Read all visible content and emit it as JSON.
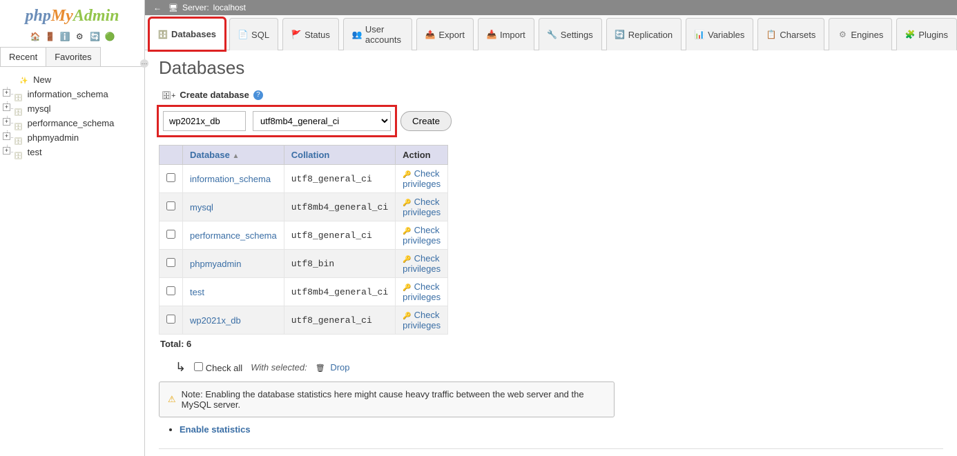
{
  "logo": {
    "php": "php",
    "my": "My",
    "admin": "Admin"
  },
  "sidebar": {
    "recent_label": "Recent",
    "favorites_label": "Favorites",
    "new_label": "New",
    "tree": [
      {
        "name": "information_schema"
      },
      {
        "name": "mysql"
      },
      {
        "name": "performance_schema"
      },
      {
        "name": "phpmyadmin"
      },
      {
        "name": "test"
      }
    ]
  },
  "server_bar": {
    "server_label": "Server:",
    "server_name": "localhost"
  },
  "tabs": {
    "databases": "Databases",
    "sql": "SQL",
    "status": "Status",
    "user_accounts": "User accounts",
    "export": "Export",
    "import": "Import",
    "settings": "Settings",
    "replication": "Replication",
    "variables": "Variables",
    "charsets": "Charsets",
    "engines": "Engines",
    "plugins": "Plugins"
  },
  "page": {
    "title": "Databases"
  },
  "create": {
    "header": "Create database",
    "db_name_value": "wp2021x_db",
    "collation_value": "utf8mb4_general_ci",
    "button": "Create"
  },
  "table": {
    "headers": {
      "db": "Database",
      "collation": "Collation",
      "action": "Action"
    },
    "action_label": "Check privileges",
    "rows": [
      {
        "name": "information_schema",
        "collation": "utf8_general_ci"
      },
      {
        "name": "mysql",
        "collation": "utf8mb4_general_ci"
      },
      {
        "name": "performance_schema",
        "collation": "utf8_general_ci"
      },
      {
        "name": "phpmyadmin",
        "collation": "utf8_bin"
      },
      {
        "name": "test",
        "collation": "utf8mb4_general_ci"
      },
      {
        "name": "wp2021x_db",
        "collation": "utf8_general_ci"
      }
    ],
    "total_label": "Total: 6"
  },
  "bulk": {
    "check_all": "Check all",
    "with_selected": "With selected:",
    "drop": "Drop"
  },
  "note": {
    "text": "Note: Enabling the database statistics here might cause heavy traffic between the web server and the MySQL server.",
    "enable": "Enable statistics"
  }
}
